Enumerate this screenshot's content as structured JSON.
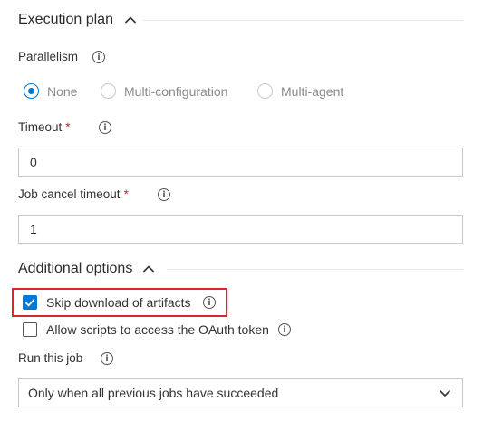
{
  "execution_plan": {
    "title": "Execution plan",
    "parallelism": {
      "label": "Parallelism",
      "options": [
        "None",
        "Multi-configuration",
        "Multi-agent"
      ],
      "selected": "None"
    },
    "timeout": {
      "label": "Timeout",
      "required_mark": "*",
      "value": "0"
    },
    "job_cancel_timeout": {
      "label": "Job cancel timeout",
      "required_mark": "*",
      "value": "1"
    }
  },
  "additional_options": {
    "title": "Additional options",
    "skip_download": {
      "label": "Skip download of artifacts",
      "checked": true
    },
    "allow_scripts": {
      "label": "Allow scripts to access the OAuth token",
      "checked": false
    },
    "run_this_job": {
      "label": "Run this job",
      "selected": "Only when all previous jobs have succeeded"
    }
  },
  "info_glyph": "i",
  "colors": {
    "accent": "#0078d4",
    "highlight": "#e0242a",
    "required": "#c4262e"
  }
}
